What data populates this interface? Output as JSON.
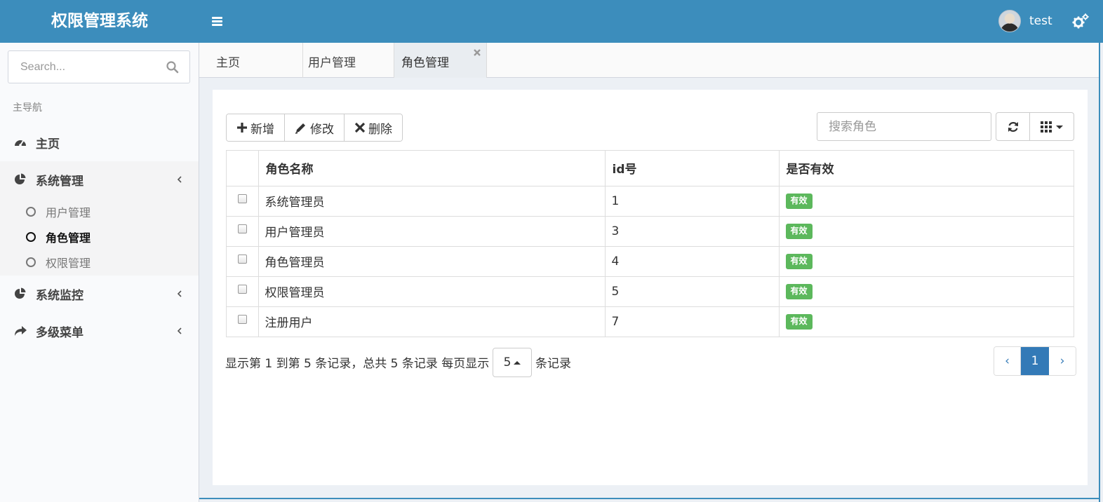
{
  "header": {
    "logo": "权限管理系统",
    "username": "test"
  },
  "sidebar": {
    "search_placeholder": "Search...",
    "nav_header": "主导航",
    "items": [
      {
        "label": "主页",
        "icon": "dashboard-icon"
      },
      {
        "label": "系统管理",
        "icon": "pie-chart-icon",
        "expanded": true,
        "children": [
          {
            "label": "用户管理",
            "active": false
          },
          {
            "label": "角色管理",
            "active": true
          },
          {
            "label": "权限管理",
            "active": false
          }
        ]
      },
      {
        "label": "系统监控",
        "icon": "pie-chart-icon"
      },
      {
        "label": "多级菜单",
        "icon": "share-icon"
      }
    ]
  },
  "tabs": [
    {
      "label": "主页",
      "active": false
    },
    {
      "label": "用户管理",
      "active": false
    },
    {
      "label": "角色管理",
      "active": true,
      "closable": true
    }
  ],
  "toolbar": {
    "add_label": "新增",
    "edit_label": "修改",
    "delete_label": "删除",
    "search_placeholder": "搜索角色"
  },
  "table": {
    "columns": [
      "角色名称",
      "id号",
      "是否有效"
    ],
    "rows": [
      {
        "name": "系统管理员",
        "id": "1",
        "status": "有效"
      },
      {
        "name": "用户管理员",
        "id": "3",
        "status": "有效"
      },
      {
        "name": "角色管理员",
        "id": "4",
        "status": "有效"
      },
      {
        "name": "权限管理员",
        "id": "5",
        "status": "有效"
      },
      {
        "name": "注册用户",
        "id": "7",
        "status": "有效"
      }
    ]
  },
  "pagination": {
    "info": "显示第 1 到第 5 条记录，总共 5 条记录 每页显示",
    "page_size": "5",
    "suffix": "条记录",
    "prev": "‹",
    "current_page": "1",
    "next": "›"
  },
  "colors": {
    "header": "#3c8dbc",
    "badge": "#5cb85c",
    "pager_active": "#337ab7"
  }
}
